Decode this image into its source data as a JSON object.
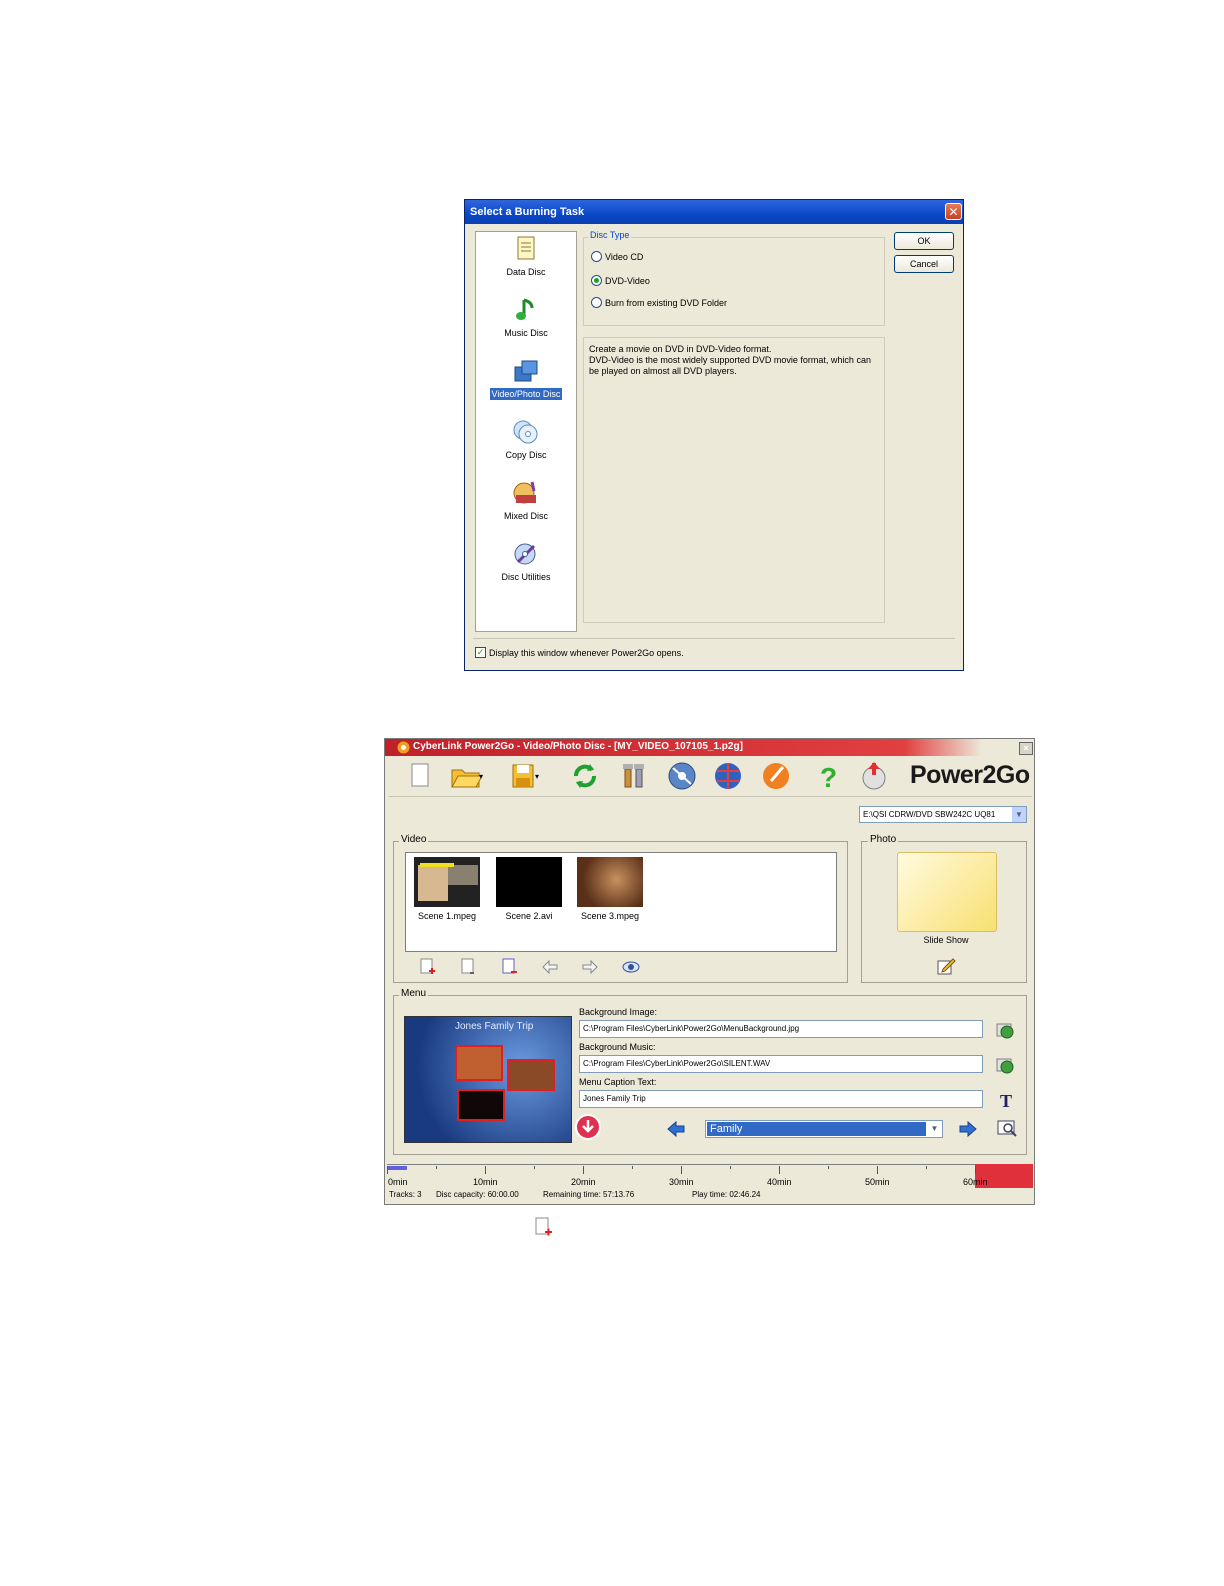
{
  "dialog": {
    "title": "Select a Burning Task",
    "close_glyph": "✕",
    "tasks": [
      {
        "label": "Data Disc",
        "icon": "data-disc-icon"
      },
      {
        "label": "Music Disc",
        "icon": "music-disc-icon"
      },
      {
        "label": "Video/Photo Disc",
        "icon": "video-photo-disc-icon",
        "selected": true
      },
      {
        "label": "Copy Disc",
        "icon": "copy-disc-icon"
      },
      {
        "label": "Mixed Disc",
        "icon": "mixed-disc-icon"
      },
      {
        "label": "Disc Utilities",
        "icon": "disc-utilities-icon"
      }
    ],
    "disc_type_label": "Disc Type",
    "disc_types": [
      {
        "label": "Video CD",
        "checked": false
      },
      {
        "label": "DVD-Video",
        "checked": true
      },
      {
        "label": "Burn from existing DVD Folder",
        "checked": false
      }
    ],
    "description_line1": "Create a movie on DVD in DVD-Video format.",
    "description_line2": "DVD-Video is the most widely supported DVD movie format, which can be played on almost all DVD players.",
    "ok_label": "OK",
    "cancel_label": "Cancel",
    "display_checkbox_label": "Display this window whenever Power2Go opens.",
    "display_checkbox_checked": true
  },
  "window": {
    "title": "CyberLink Power2Go - Video/Photo Disc - [MY_VIDEO_107105_1.p2g]",
    "brand": "Power2Go",
    "drive": "E:\\QSI CDRW/DVD SBW242C UQ81",
    "video_label": "Video",
    "clips": [
      {
        "label": "Scene 1.mpeg"
      },
      {
        "label": "Scene 2.avi"
      },
      {
        "label": "Scene 3.mpeg"
      }
    ],
    "photo_label": "Photo",
    "slide_show_label": "Slide Show",
    "menu_label": "Menu",
    "menu_preview_title": "Jones Family Trip",
    "background_image_label": "Background Image:",
    "background_image_value": "C:\\Program Files\\CyberLink\\Power2Go\\MenuBackground.jpg",
    "background_music_label": "Background Music:",
    "background_music_value": "C:\\Program Files\\CyberLink\\Power2Go\\SILENT.WAV",
    "caption_label": "Menu Caption Text:",
    "caption_value": "Jones Family Trip",
    "template_value": "Family",
    "timeline_labels": [
      "0min",
      "10min",
      "20min",
      "30min",
      "40min",
      "50min",
      "60min"
    ],
    "tracks": "Tracks: 3",
    "disc_capacity": "Disc capacity: 60:00.00",
    "remaining_time": "Remaining time: 57:13.76",
    "play_time": "Play time: 02:46.24",
    "accent_red": "#e0303c"
  }
}
